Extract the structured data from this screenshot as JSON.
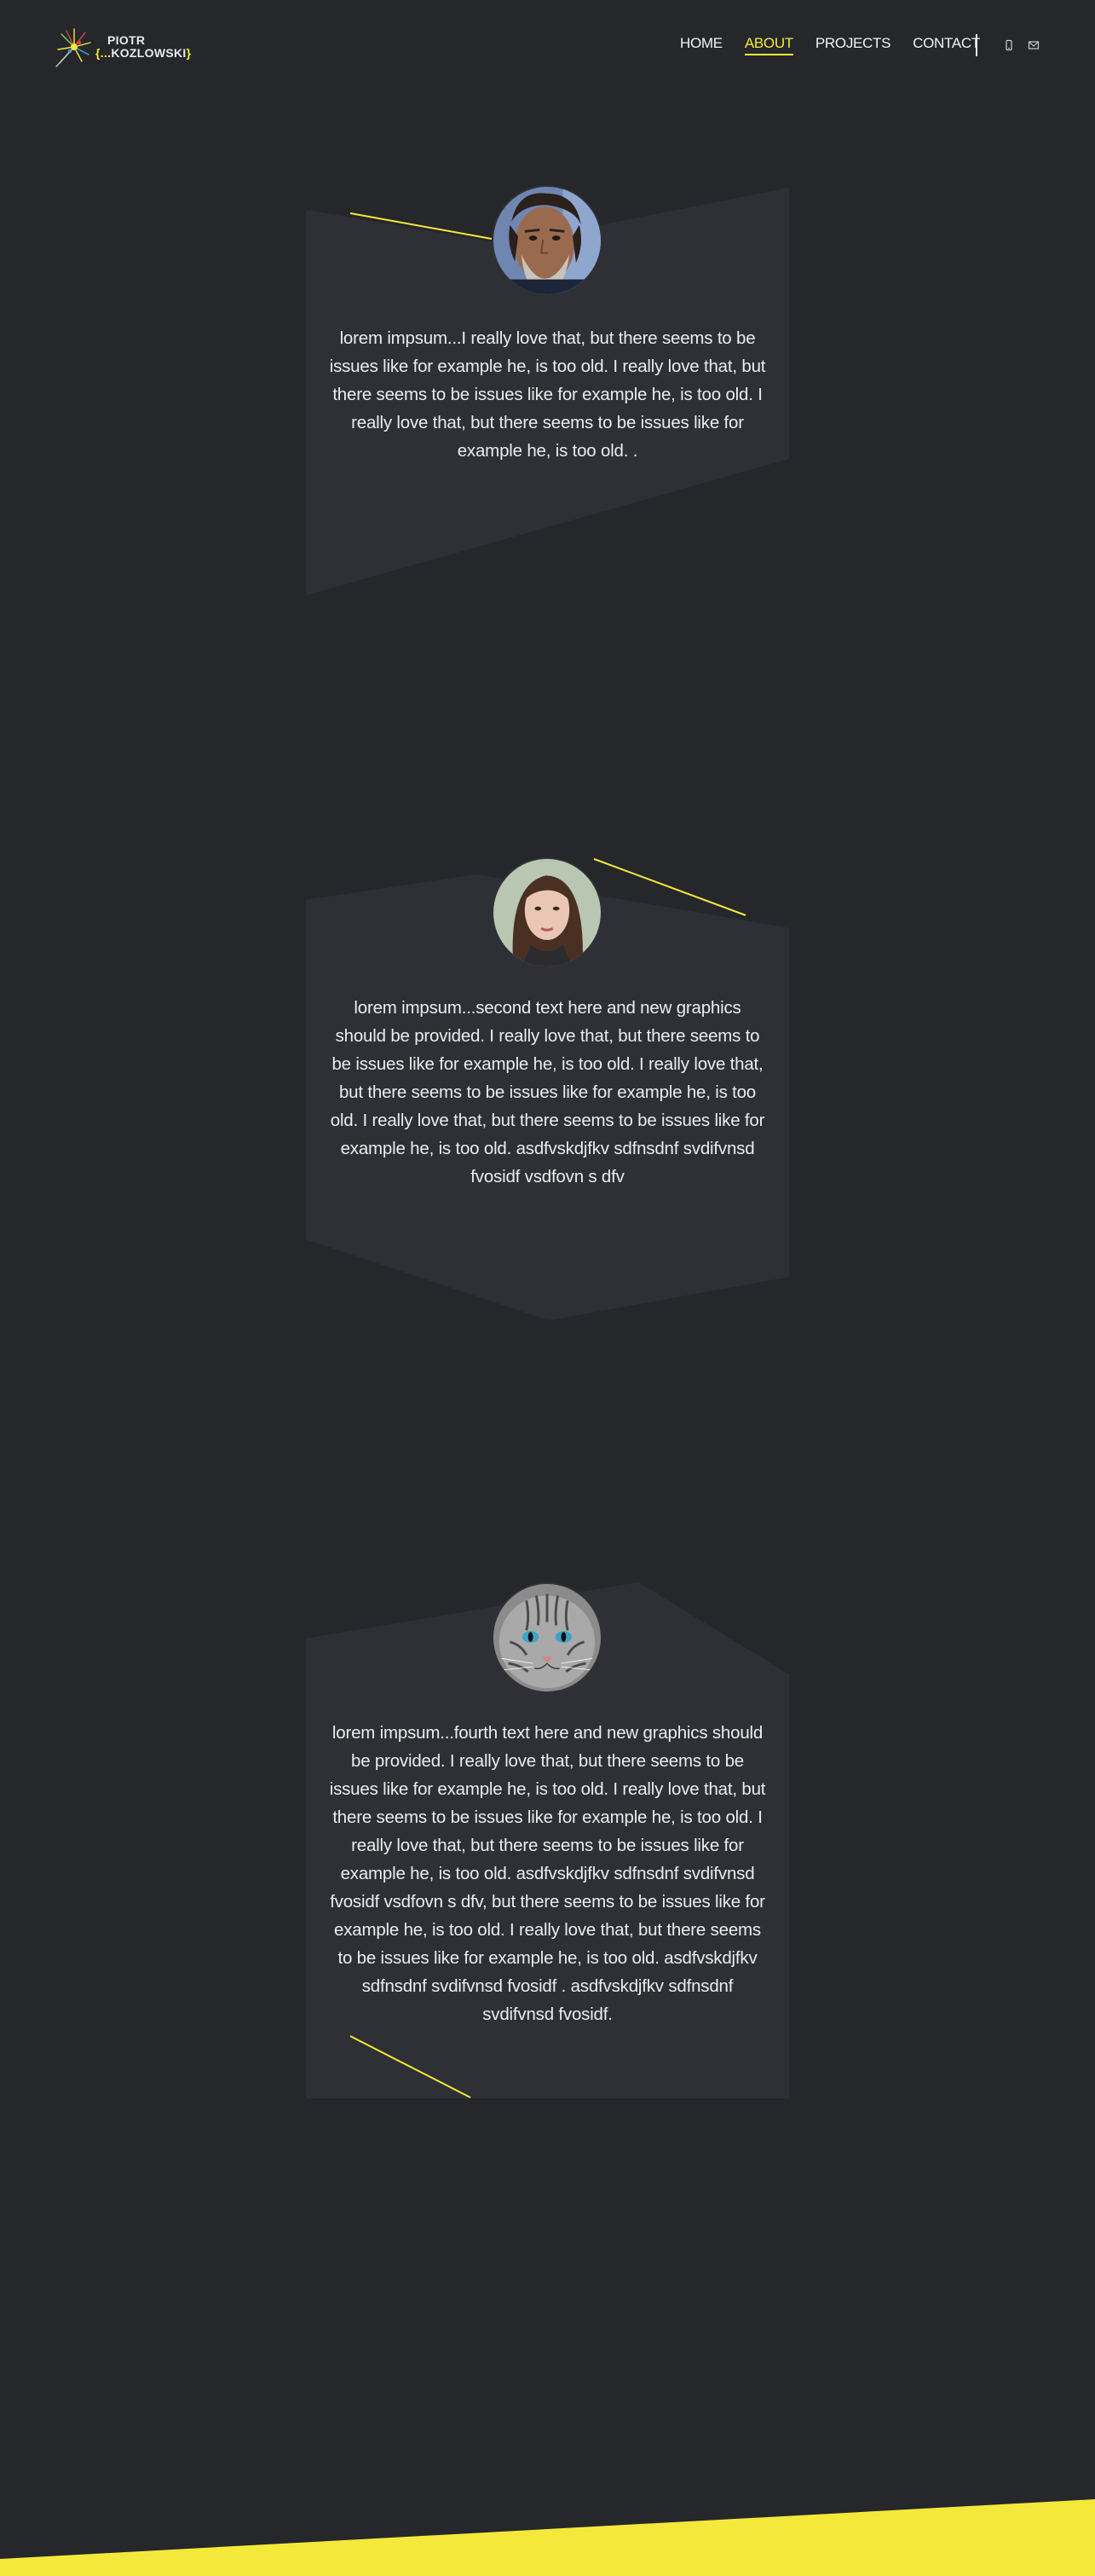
{
  "header": {
    "logo_line1": "PIOTR",
    "logo_open": "{...",
    "logo_name": "KOZLOWSKI",
    "logo_close": "}",
    "nav": [
      {
        "label": "HOME",
        "active": false
      },
      {
        "label": "ABOUT",
        "active": true
      },
      {
        "label": "PROJECTS",
        "active": false
      },
      {
        "label": "CONTACT",
        "active": false
      }
    ],
    "icons": [
      "mobile-icon",
      "email-icon"
    ]
  },
  "colors": {
    "background": "#25272b",
    "card": "#2e3036",
    "accent": "#f4e93a",
    "text": "#ececec"
  },
  "testimonials": [
    {
      "avatar": "bearded-man-portrait",
      "text": "lorem impsum...I really love that, but there seems to be issues like for example he, is too old. I really love that, but there seems to be issues like for example he, is too old. I really love that, but there seems to be issues like for example he, is too old. ."
    },
    {
      "avatar": "young-woman-portrait",
      "text": "lorem impsum...second text here and new graphics should be provided. I really love that, but there seems to be issues like for example he, is too old. I really love that, but there seems to be issues like for example he, is too old. I really love that, but there seems to be issues like for example he, is too old. asdfvskdjfkv sdfnsdnf svdifvnsd fvosidf vsdfovn s dfv"
    },
    {
      "avatar": "grey-cat-portrait",
      "text": "lorem impsum...fourth text here and new graphics should be provided. I really love that, but there seems to be issues like for example he, is too old. I really love that, but there seems to be issues like for example he, is too old. I really love that, but there seems to be issues like for example he, is too old. asdfvskdjfkv sdfnsdnf svdifvnsd fvosidf vsdfovn s dfv, but there seems to be issues like for example he, is too old. I really love that, but there seems to be issues like for example he, is too old. asdfvskdjfkv sdfnsdnf svdifvnsd fvosidf . asdfvskdjfkv sdfnsdnf svdifvnsd fvosidf."
    }
  ]
}
